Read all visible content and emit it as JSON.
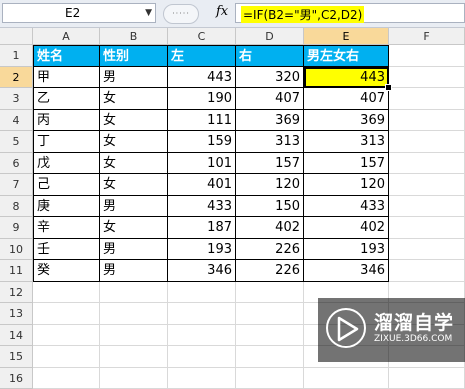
{
  "formula_bar": {
    "name_box": "E2",
    "fx_label": "fx",
    "formula": "=IF(B2=\"男\",C2,D2)"
  },
  "columns": [
    "A",
    "B",
    "C",
    "D",
    "E",
    "F"
  ],
  "rows": [
    "1",
    "2",
    "3",
    "4",
    "5",
    "6",
    "7",
    "8",
    "9",
    "10",
    "11",
    "12",
    "13",
    "14",
    "15",
    "16"
  ],
  "table": {
    "headers": [
      "姓名",
      "性别",
      "左",
      "右",
      "男左女右"
    ],
    "data": [
      [
        "甲",
        "男",
        "443",
        "320",
        "443"
      ],
      [
        "乙",
        "女",
        "190",
        "407",
        "407"
      ],
      [
        "丙",
        "女",
        "111",
        "369",
        "369"
      ],
      [
        "丁",
        "女",
        "159",
        "313",
        "313"
      ],
      [
        "戊",
        "女",
        "101",
        "157",
        "157"
      ],
      [
        "己",
        "女",
        "401",
        "120",
        "120"
      ],
      [
        "庚",
        "男",
        "433",
        "150",
        "433"
      ],
      [
        "辛",
        "女",
        "187",
        "402",
        "402"
      ],
      [
        "壬",
        "男",
        "193",
        "226",
        "193"
      ],
      [
        "癸",
        "男",
        "346",
        "226",
        "346"
      ]
    ]
  },
  "watermark": {
    "title": "溜溜自学",
    "url": "ZIXUE.3D66.COM"
  },
  "colors": {
    "header_fill": "#00b0f0",
    "highlight": "#ffff00",
    "selected_header": "#f9d99a"
  }
}
